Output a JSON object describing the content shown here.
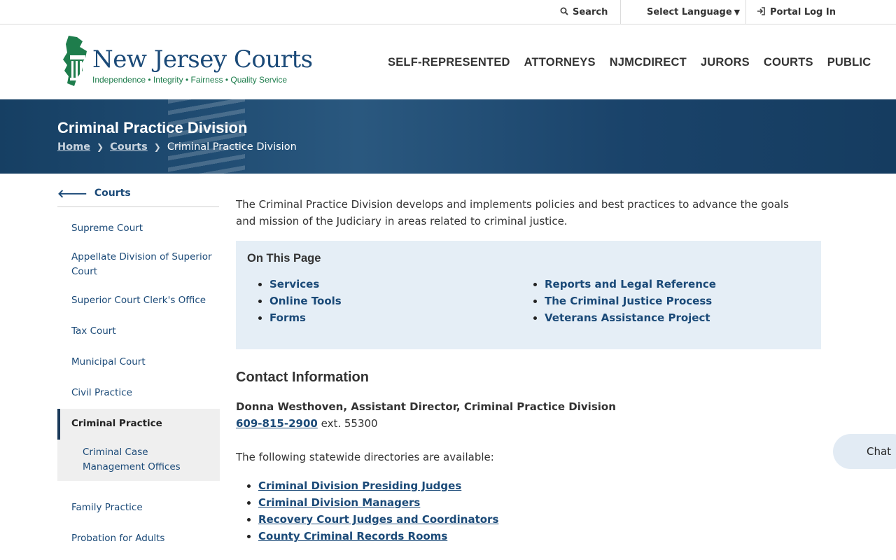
{
  "utility": {
    "search_label": "Search",
    "language_label": "Select Language",
    "portal_label": "Portal Log In"
  },
  "logo": {
    "title": "New Jersey Courts",
    "tagline": "Independence • Integrity • Fairness • Quality Service",
    "colors": {
      "green": "#1e7d4c",
      "blue": "#1b4a78"
    }
  },
  "nav": [
    "SELF-REPRESENTED",
    "ATTORNEYS",
    "NJMCDIRECT",
    "JURORS",
    "COURTS",
    "PUBLIC"
  ],
  "banner": {
    "title": "Criminal Practice Division",
    "breadcrumbs": [
      "Home",
      "Courts"
    ],
    "current": "Criminal Practice Division"
  },
  "sidebar": {
    "back_label": "Courts",
    "items": [
      "Supreme Court",
      "Appellate Division of Superior Court",
      "Superior Court Clerk's Office",
      "Tax Court",
      "Municipal Court",
      "Civil Practice",
      "Criminal Practice",
      "Criminal Case Management Offices",
      "Family Practice",
      "Probation for Adults"
    ]
  },
  "main": {
    "intro": "The Criminal Practice Division develops and implements policies and best practices to advance the goals and mission of the Judiciary in areas related to criminal justice.",
    "on_this_page": {
      "title": "On This Page",
      "col1": [
        "Services",
        "Online Tools",
        "Forms"
      ],
      "col2": [
        "Reports and Legal Reference",
        "The Criminal Justice Process",
        "Veterans Assistance Project"
      ]
    },
    "contact": {
      "heading": "Contact Information",
      "name": "Donna Westhoven, Assistant Director, Criminal Practice Division",
      "phone": "609-815-2900",
      "ext": "ext. 55300"
    },
    "directories_intro": "The following statewide directories are available:",
    "directories": [
      "Criminal Division Presiding Judges",
      "Criminal Division Managers",
      "Recovery Court Judges and Coordinators",
      "County Criminal Records Rooms"
    ]
  },
  "chat_label": "Chat"
}
